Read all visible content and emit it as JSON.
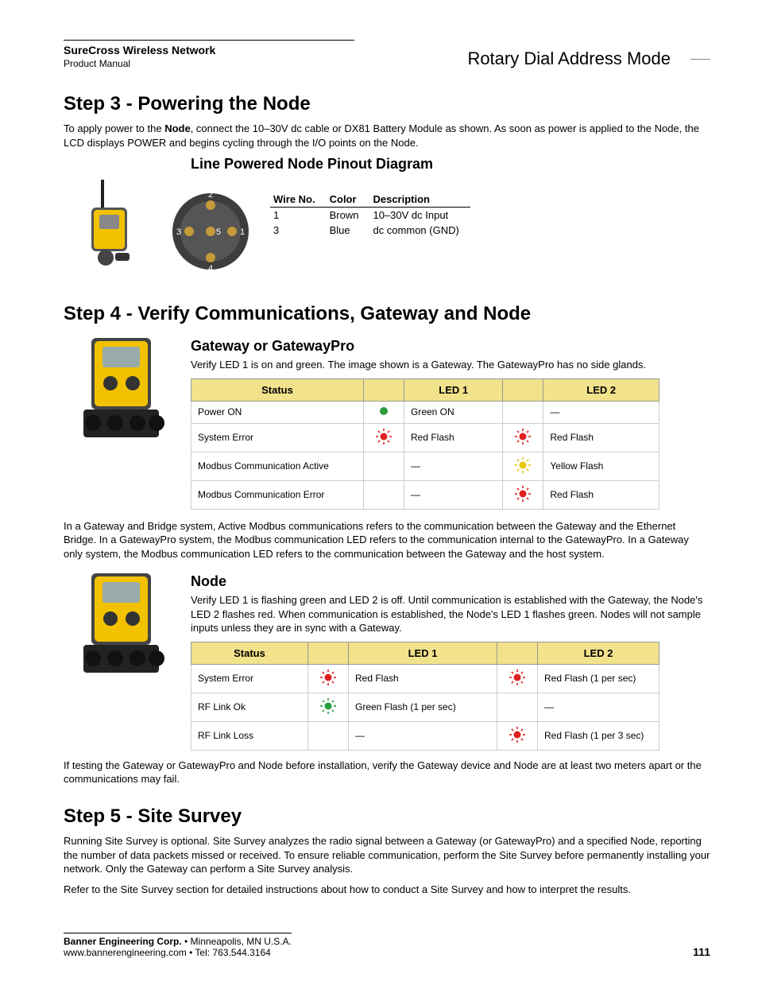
{
  "header": {
    "product_line": "SureCross Wireless Network",
    "doc_type": "Product Manual",
    "section_title": "Rotary Dial Address Mode"
  },
  "step3": {
    "heading": "Step 3 - Powering the Node",
    "intro_a": "To apply power to the ",
    "intro_bold": "Node",
    "intro_b": ", connect the 10–30V dc cable or DX81 Battery Module as shown. As soon as power is applied to the Node, the LCD displays POWER and begins cycling through the I/O points on the Node.",
    "pinout_heading": "Line Powered Node Pinout Diagram",
    "pinout": {
      "cols": {
        "wire": "Wire No.",
        "color": "Color",
        "desc": "Description"
      },
      "rows": [
        {
          "wire": "1",
          "color": "Brown",
          "desc": "10–30V dc Input"
        },
        {
          "wire": "3",
          "color": "Blue",
          "desc": "dc common (GND)"
        }
      ]
    },
    "connector_labels": [
      "1",
      "2",
      "3",
      "4",
      "5"
    ]
  },
  "step4": {
    "heading": "Step 4 - Verify Communications, Gateway and Node",
    "gw_heading": "Gateway or GatewayPro",
    "gw_intro": "Verify LED 1 is on and green. The image shown is a Gateway. The GatewayPro has no side glands.",
    "cols": {
      "status": "Status",
      "led1": "LED 1",
      "led2": "LED 2"
    },
    "gw_rows": [
      {
        "status": "Power ON",
        "led1_icon": "green-solid",
        "led1": "Green ON",
        "led2_icon": "",
        "led2": "—"
      },
      {
        "status": "System Error",
        "led1_icon": "red-flash",
        "led1": "Red Flash",
        "led2_icon": "red-flash",
        "led2": "Red Flash"
      },
      {
        "status": "Modbus Communication Active",
        "led1_icon": "",
        "led1": "—",
        "led2_icon": "yellow-flash",
        "led2": "Yellow Flash"
      },
      {
        "status": "Modbus Communication Error",
        "led1_icon": "",
        "led1": "—",
        "led2_icon": "red-flash",
        "led2": "Red Flash"
      }
    ],
    "gw_note": "In a Gateway and Bridge system, Active Modbus communications refers to the communication between the Gateway and the Ethernet Bridge. In a GatewayPro system, the Modbus communication LED refers to the communication internal to the GatewayPro. In a Gateway only system, the Modbus communication LED refers to the communication between the Gateway and the host system.",
    "node_heading": "Node",
    "node_intro": "Verify LED 1 is flashing green and LED 2 is off. Until communication is established with the Gateway, the Node's LED 2 flashes red. When communication is established, the Node's LED 1 flashes green. Nodes will not sample inputs unless they are in sync with a Gateway.",
    "node_rows": [
      {
        "status": "System Error",
        "led1_icon": "red-flash",
        "led1": "Red Flash",
        "led2_icon": "red-flash",
        "led2": "Red Flash (1 per sec)"
      },
      {
        "status": "RF Link Ok",
        "led1_icon": "green-flash",
        "led1": "Green Flash (1 per sec)",
        "led2_icon": "",
        "led2": "—"
      },
      {
        "status": "RF Link Loss",
        "led1_icon": "",
        "led1": "—",
        "led2_icon": "red-flash",
        "led2": "Red Flash (1 per 3 sec)"
      }
    ],
    "node_note": "If testing the Gateway or GatewayPro and Node before installation, verify the Gateway device and Node are at least two meters apart or the communications may fail."
  },
  "step5": {
    "heading": "Step 5 - Site Survey",
    "p1": "Running Site Survey is optional. Site Survey analyzes the radio signal between a Gateway (or GatewayPro) and a specified Node, reporting the number of data packets missed or received. To ensure reliable communication, perform the Site Survey before permanently installing your network. Only the Gateway can perform a Site Survey analysis.",
    "p2": "Refer to the Site Survey section for detailed instructions about how to conduct a Site Survey and how to interpret the results."
  },
  "footer": {
    "company": "Banner Engineering Corp.",
    "location": " • Minneapolis, MN U.S.A.",
    "contact": "www.bannerengineering.com  •  Tel: 763.544.3164",
    "page": "111"
  },
  "icons": {
    "green-solid": "#2a9d3e",
    "red-flash": "#e02020",
    "yellow-flash": "#e6c800",
    "green-flash": "#2a9d3e"
  }
}
